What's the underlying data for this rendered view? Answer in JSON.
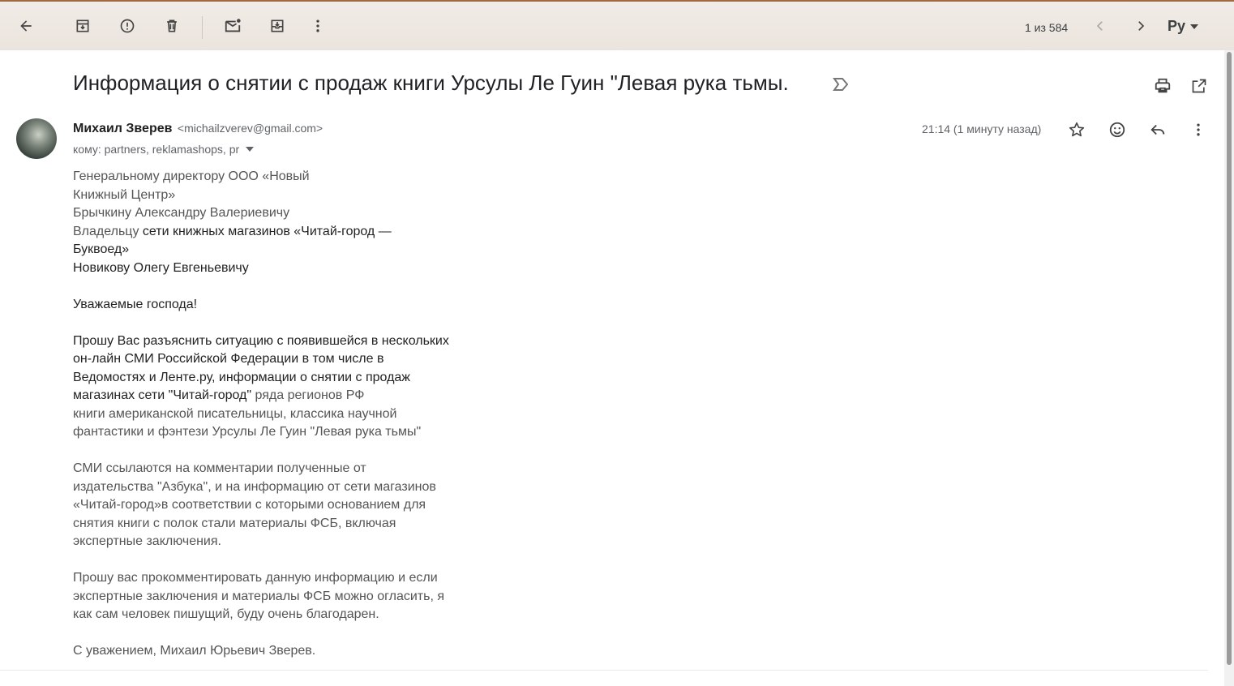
{
  "toolbar": {
    "counter": "1 из 584",
    "lang": "Ру",
    "icons": [
      "back-arrow-icon",
      "archive-icon",
      "report-spam-icon",
      "delete-icon",
      "mark-unread-icon",
      "move-to-icon",
      "more-vert-icon",
      "prev-chevron-icon",
      "next-chevron-icon"
    ]
  },
  "email": {
    "subject": "Информация о снятии с продаж книги Урсулы Ле Гуин \"Левая рука тьмы.",
    "sender_name": "Михаил Зверев",
    "sender_email": "<michailzverev@gmail.com>",
    "recipients": "кому: partners, reklamashops, pr",
    "time": "21:14 (1 минуту назад)",
    "body": {
      "l1": "Генеральному директору ООО «Новый",
      "l2": "Книжный Центр»",
      "l3": "Брычкину Александру Валериевичу",
      "l4a": "Владельцу ",
      "l4b": "сети книжных магазинов «Читай-город —",
      "l5": "Буквоед»",
      "l6": "Новикову Олегу Евгеньевичу",
      "greeting": "Уважаемые господа!",
      "p1_1": "Прошу Вас разъяснить ситуацию с появившейся в нескольких",
      "p1_2": "он-лайн СМИ Российской Федерации в том числе в",
      "p1_3": "Ведомостях и Ленте.ру, информации о снятии с продаж",
      "p1_4a": "магазинах сети \"Читай-город\"",
      "p1_4b": " ряда регионов РФ",
      "p1_5": "книги американской писательницы, классика научной",
      "p1_6": "фантастики и фэнтези Урсулы Ле Гуин \"Левая рука тьмы\"",
      "p2_1": "СМИ ссылаются на комментарии полученные от",
      "p2_2": "издательства \"Азбука\", и на информацию от сети магазинов",
      "p2_3": "«Читай-город»в соответствии с которыми основанием для",
      "p2_4": "снятия книги с полок стали материалы ФСБ, включая",
      "p2_5": "экспертные заключения.",
      "p3_1": "Прошу вас прокомментировать данную информацию и если",
      "p3_2": "экспертные заключения и материалы ФСБ можно огласить, я",
      "p3_3": "как сам человек пишущий, буду очень благодарен.",
      "sign": "С уважением, Михаил Юрьевич Зверев."
    }
  }
}
